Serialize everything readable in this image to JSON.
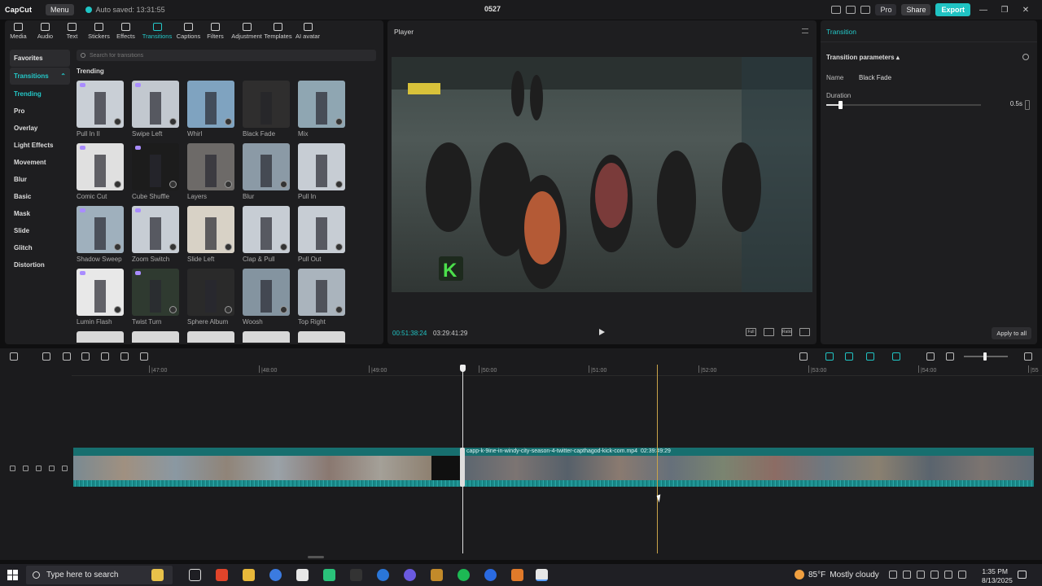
{
  "titlebar": {
    "logo": "CapCut",
    "menu_label": "Menu",
    "autosave": "Auto saved: 13:31:55",
    "project_title": "0527",
    "pro_label": "Pro",
    "share_label": "Share",
    "export_label": "Export"
  },
  "tabs": [
    {
      "label": "Media",
      "icon": "media-icon"
    },
    {
      "label": "Audio",
      "icon": "audio-icon"
    },
    {
      "label": "Text",
      "icon": "text-icon"
    },
    {
      "label": "Stickers",
      "icon": "stickers-icon"
    },
    {
      "label": "Effects",
      "icon": "effects-icon"
    },
    {
      "label": "Transitions",
      "icon": "transitions-icon"
    },
    {
      "label": "Captions",
      "icon": "captions-icon"
    },
    {
      "label": "Filters",
      "icon": "filters-icon"
    },
    {
      "label": "Adjustment",
      "icon": "adjustment-icon"
    },
    {
      "label": "Templates",
      "icon": "templates-icon"
    },
    {
      "label": "AI avatar",
      "icon": "ai-avatar-icon"
    }
  ],
  "categories": [
    "Favorites",
    "Transitions",
    "Trending",
    "Pro",
    "Overlay",
    "Light Effects",
    "Movement",
    "Blur",
    "Basic",
    "Mask",
    "Slide",
    "Glitch",
    "Distortion"
  ],
  "search": {
    "placeholder": "Search for transitions"
  },
  "section_title": "Trending",
  "transitions": [
    {
      "label": "Pull In II",
      "color": "#c9cfd6"
    },
    {
      "label": "Swipe Left",
      "color": "#c2c8cf"
    },
    {
      "label": "Whirl",
      "color": "#7fa3c0"
    },
    {
      "label": "Black Fade",
      "color": "#3b3a38"
    },
    {
      "label": "Mix",
      "color": "#8fa6b2"
    },
    {
      "label": "Comic Cut",
      "color": "#e0e0e0"
    },
    {
      "label": "Cube Shuffle",
      "color": "#1c1c1c"
    },
    {
      "label": "Layers",
      "color": "#6d6a68"
    },
    {
      "label": "Blur",
      "color": "#8b9aa6"
    },
    {
      "label": "Pull In",
      "color": "#c7cdd4"
    },
    {
      "label": "Shadow Sweep",
      "color": "#9fb0bd"
    },
    {
      "label": "Zoom Switch",
      "color": "#c7cdd4"
    },
    {
      "label": "Slide Left",
      "color": "#d8d2c6"
    },
    {
      "label": "Clap & Pull",
      "color": "#c7cdd4"
    },
    {
      "label": "Pull Out",
      "color": "#c7cdd4"
    },
    {
      "label": "Lumin Flash",
      "color": "#e8e8e8"
    },
    {
      "label": "Twist Turn",
      "color": "#2f3a30"
    },
    {
      "label": "Sphere Album",
      "color": "#2a2a2a"
    },
    {
      "label": "Woosh",
      "color": "#8494a0"
    },
    {
      "label": "Top Right",
      "color": "#aab4bd"
    }
  ],
  "player": {
    "title": "Player",
    "current_time": "00:51:38:24",
    "total_time": "03:29:41:29",
    "controls": [
      "Full",
      "Ratio"
    ]
  },
  "transition_panel": {
    "title": "Transition",
    "params_label": "Transition parameters",
    "name_label": "Name",
    "name_value": "Black Fade",
    "duration_label": "Duration",
    "duration_value": "0.5s",
    "duration_fraction": 0.09,
    "apply_label": "Apply to all"
  },
  "timeline": {
    "ticks": [
      "|47:00",
      "|48:00",
      "|49:00",
      "|50:00",
      "|51:00",
      "|52:00",
      "|53:00",
      "|54:00",
      "|55"
    ],
    "clip_name": "capp-k-9ine-in-windy-city-season-4-twitter-capthagod-kick-com.mp4",
    "clip_duration": "02:39:49:29",
    "zoom_fraction": 0.45
  },
  "taskbar": {
    "search_placeholder": "Type here to search",
    "weather_temp": "85°F",
    "weather_desc": "Mostly cloudy",
    "time": "1:35 PM",
    "date": "8/13/2025"
  }
}
